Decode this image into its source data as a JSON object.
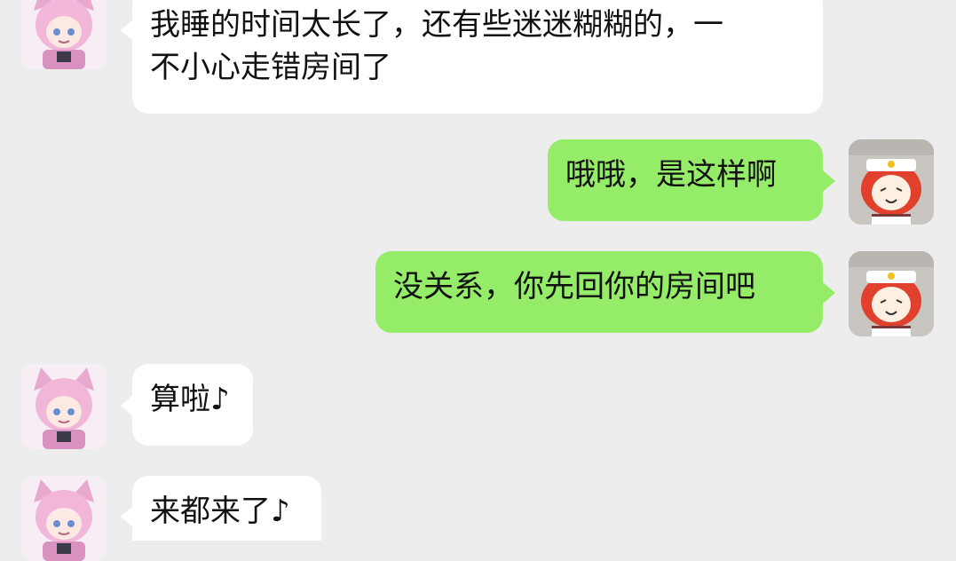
{
  "messages": [
    {
      "side": "left",
      "text": "我睡的时间太长了，还有些迷迷糊糊的，一\n不小心走错房间了",
      "avatar_icon": "pink-cat-girl-avatar-icon"
    },
    {
      "side": "right",
      "text": "哦哦，是这样啊",
      "avatar_icon": "red-hair-sailor-avatar-icon"
    },
    {
      "side": "right",
      "text": "没关系，你先回你的房间吧",
      "avatar_icon": "red-hair-sailor-avatar-icon"
    },
    {
      "side": "left",
      "text": "算啦♪",
      "avatar_icon": "pink-cat-girl-avatar-icon"
    },
    {
      "side": "left",
      "text": "来都来了♪",
      "avatar_icon": "pink-cat-girl-avatar-icon"
    }
  ],
  "colors": {
    "background": "#ededed",
    "bubble_left": "#ffffff",
    "bubble_right": "#95ec69"
  }
}
